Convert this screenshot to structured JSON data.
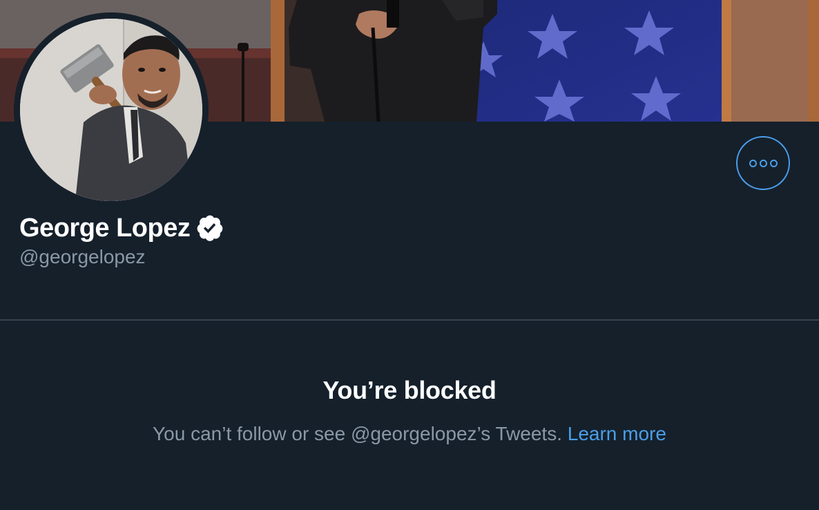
{
  "profile": {
    "display_name": "George Lopez",
    "handle": "@georgelopez",
    "verified_icon": "verified-badge-icon",
    "more_icon": "more-options-icon"
  },
  "blocked": {
    "title": "You’re blocked",
    "message": "You can’t follow or see @georgelopez’s Tweets.",
    "link_label": "Learn more"
  },
  "colors": {
    "background": "#15202b",
    "accent": "#4a9ee8",
    "secondary_text": "#8b98a5",
    "divider": "#38444d"
  }
}
